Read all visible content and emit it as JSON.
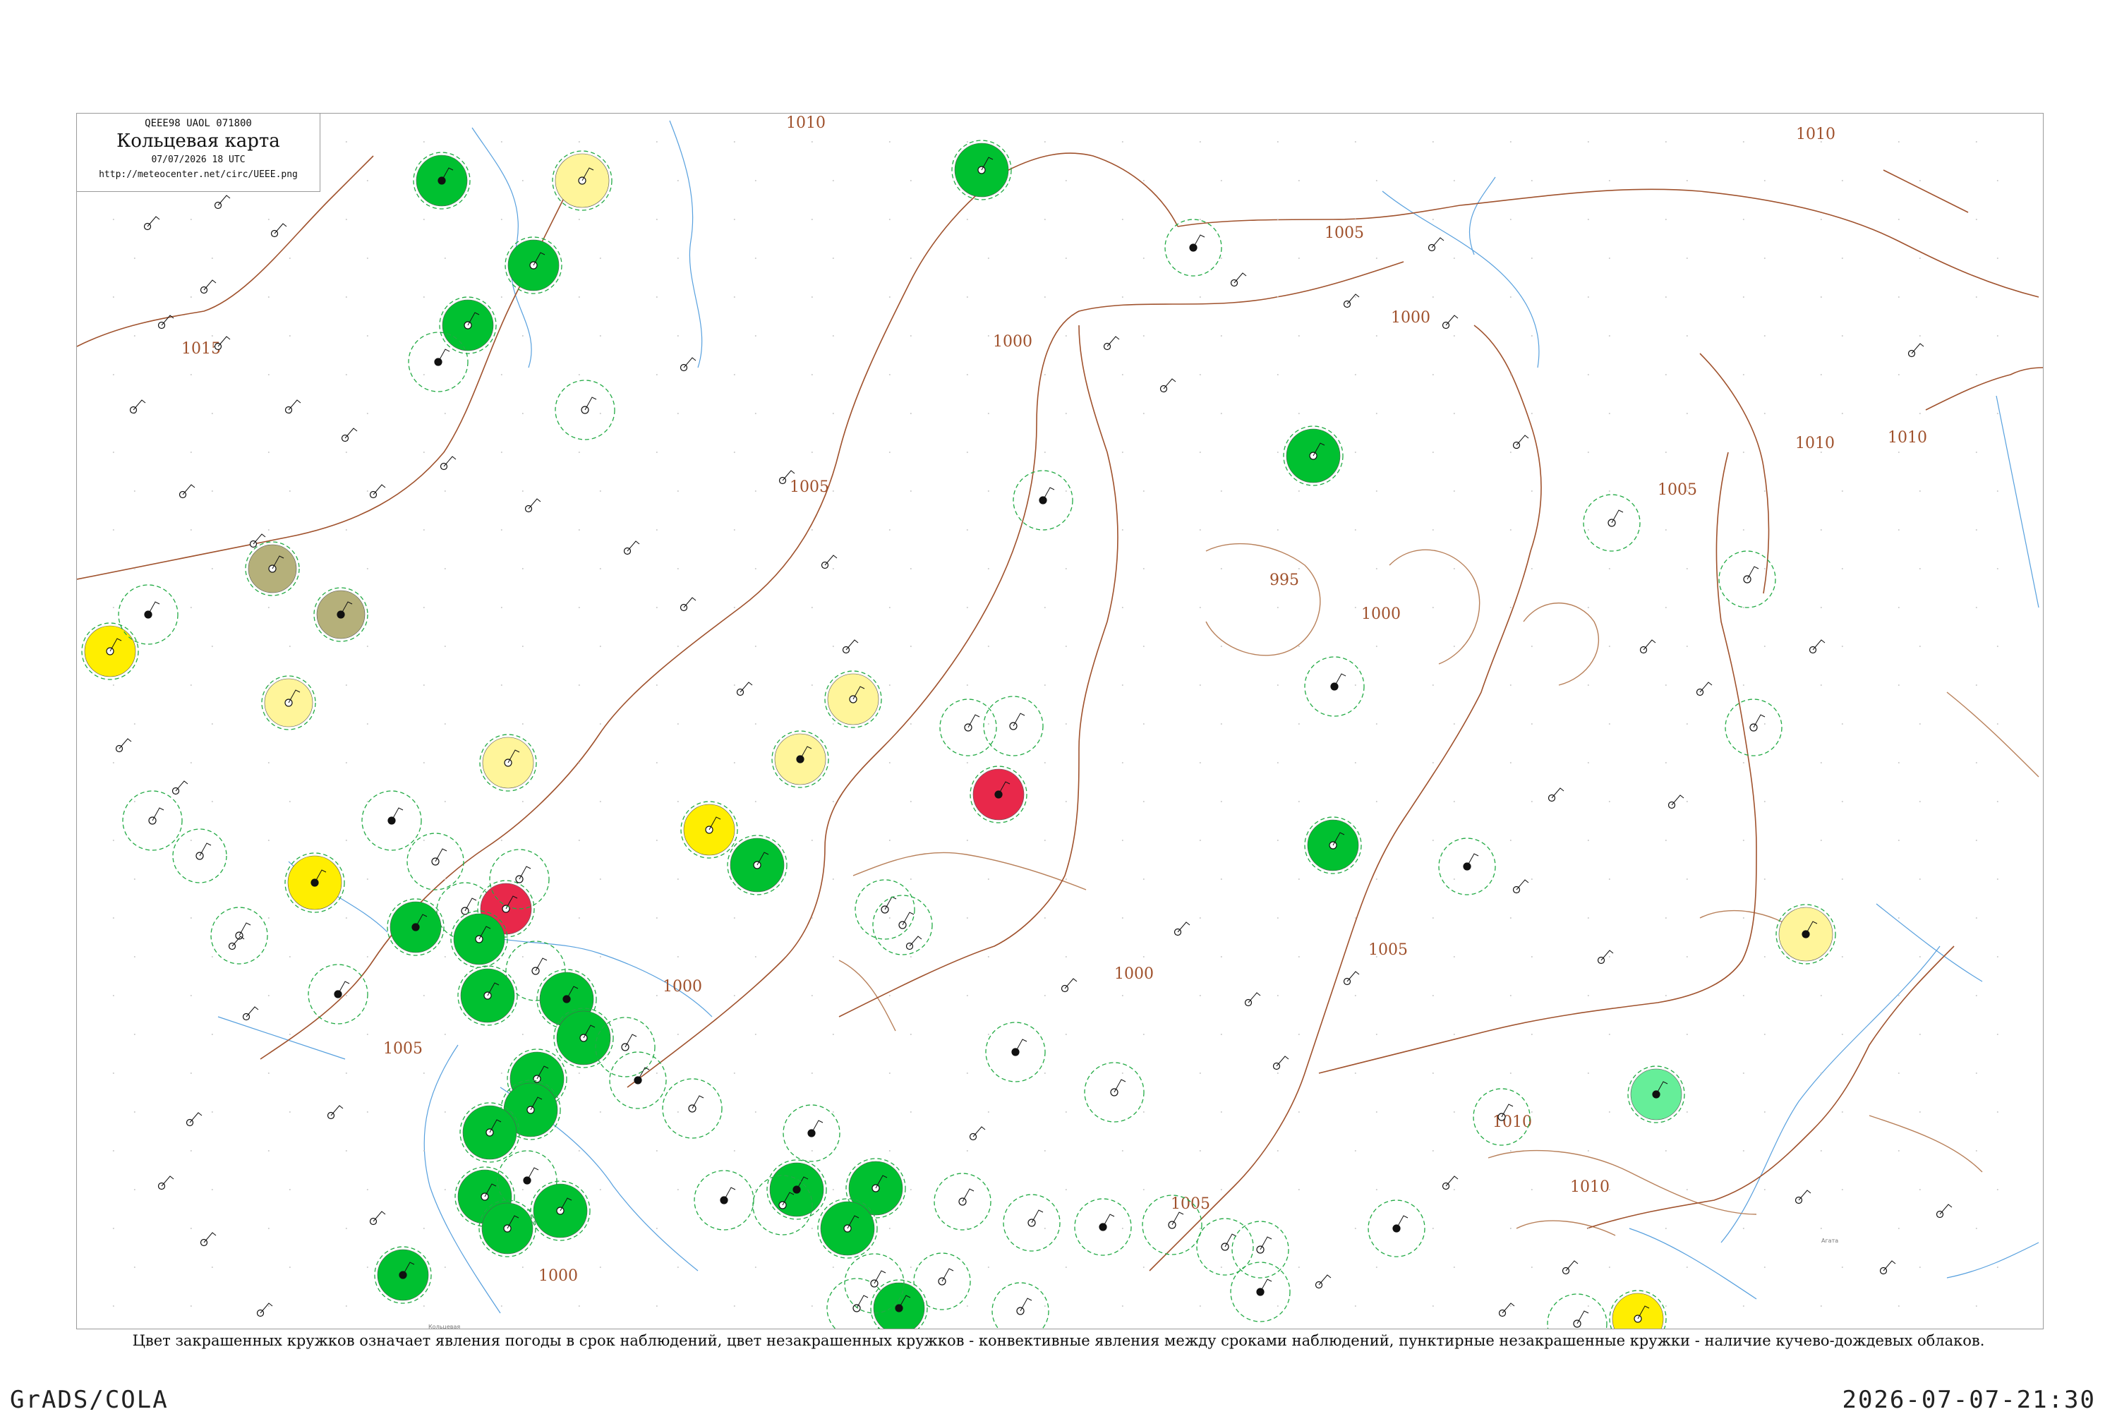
{
  "legend": {
    "code": "QEEE98  UAOL  071800",
    "title": "Кольцевая карта",
    "date": "07/07/2026 18 UTC",
    "url": "http://meteocenter.net/circ/UEEE.png"
  },
  "caption": "Цвет закрашенных кружков означает явления погоды в срок наблюдений, цвет незакрашенных кружков - конвективные явления между сроками наблюдений, пунктирные незакрашенные кружки - наличие кучево-дождевых облаков.",
  "footer": {
    "left": "GrADS/COLA",
    "right": "2026-07-07-21:30"
  },
  "colors": {
    "isobar": "#a0522d",
    "water": "#3a8fd8",
    "green_fill": "#00c030",
    "yellow_fill": "#ffee00",
    "pale_yellow_fill": "#fff59a",
    "red_fill": "#e8284a",
    "olive_fill": "#b5b07a",
    "light_green_fill": "#66ee99",
    "dashed_ring": "#22aa44"
  },
  "isobar_labels": [
    "1015",
    "1010",
    "1005",
    "1000",
    "995",
    "1010",
    "1005",
    "1000",
    "1005",
    "1000",
    "1005",
    "1000",
    "1010",
    "1010",
    "1005",
    "1010",
    "1000",
    "1005",
    "1010",
    "1000"
  ],
  "stations": [
    {
      "label": "Агата",
      "fill": "yellow"
    },
    {
      "label": "Кольцевая",
      "fill": "green"
    }
  ]
}
